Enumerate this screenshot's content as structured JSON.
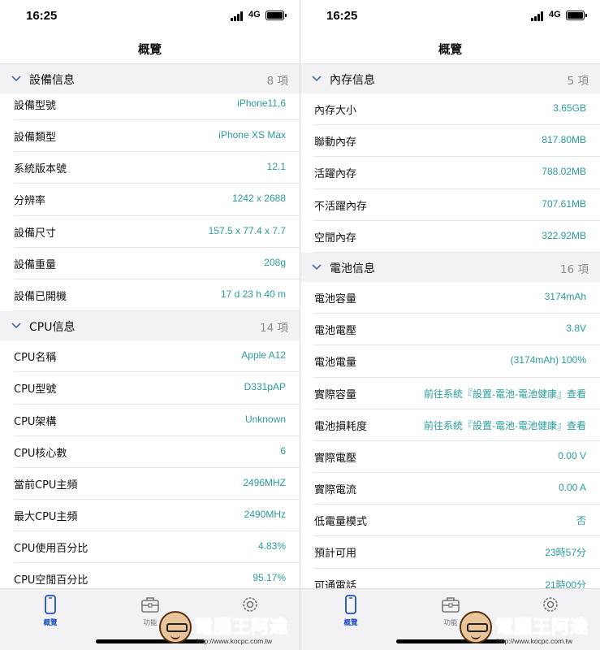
{
  "status": {
    "time": "16:25",
    "network": "4G"
  },
  "nav_title": "概覽",
  "left_sections": [
    {
      "title": "設備信息",
      "count": "8 項",
      "collapsed": false,
      "rows": [
        {
          "label": "設備型號",
          "value": "iPhone11,6"
        },
        {
          "label": "設備類型",
          "value": "iPhone XS Max"
        },
        {
          "label": "系統版本號",
          "value": "12.1"
        },
        {
          "label": "分辨率",
          "value": "1242 x 2688"
        },
        {
          "label": "設備尺寸",
          "value": "157.5 x 77.4 x 7.7"
        },
        {
          "label": "設備重量",
          "value": "208g"
        },
        {
          "label": "設備已開機",
          "value": "17 d 23 h 40 m"
        }
      ]
    },
    {
      "title": "CPU信息",
      "count": "14 項",
      "collapsed": false,
      "rows": [
        {
          "label": "CPU名稱",
          "value": "Apple A12"
        },
        {
          "label": "CPU型號",
          "value": "D331pAP"
        },
        {
          "label": "CPU架構",
          "value": "Unknown"
        },
        {
          "label": "CPU核心數",
          "value": "6"
        },
        {
          "label": "當前CPU主頻",
          "value": "2496MHZ"
        },
        {
          "label": "最大CPU主頻",
          "value": "2490MHz"
        },
        {
          "label": "CPU使用百分比",
          "value": "4.83%"
        },
        {
          "label": "CPU空閒百分比",
          "value": "95.17%"
        }
      ]
    }
  ],
  "right_sections": [
    {
      "title": "內存信息",
      "count": "5 項",
      "collapsed": false,
      "rows": [
        {
          "label": "內存大小",
          "value": "3.65GB"
        },
        {
          "label": "聯動內存",
          "value": "817.80MB"
        },
        {
          "label": "活躍內存",
          "value": "788.02MB"
        },
        {
          "label": "不活躍內存",
          "value": "707.61MB"
        },
        {
          "label": "空閒內存",
          "value": "322.92MB"
        }
      ]
    },
    {
      "title": "電池信息",
      "count": "16 項",
      "collapsed": false,
      "rows": [
        {
          "label": "電池容量",
          "value": "3174mAh"
        },
        {
          "label": "電池電壓",
          "value": "3.8V"
        },
        {
          "label": "電池電量",
          "value": "(3174mAh) 100%"
        },
        {
          "label": "實際容量",
          "value": "前往系統『設置-電池-電池健康』查看"
        },
        {
          "label": "電池損耗度",
          "value": "前往系統『設置-電池-電池健康』查看"
        },
        {
          "label": "實際電壓",
          "value": "0.00 V"
        },
        {
          "label": "實際電流",
          "value": "0.00 A"
        },
        {
          "label": "低電量模式",
          "value": "否"
        },
        {
          "label": "預計可用",
          "value": "23時57分"
        },
        {
          "label": "可通電話",
          "value": "21時00分"
        }
      ]
    }
  ],
  "tabs": [
    {
      "label": "概覽",
      "icon": "phone-icon",
      "active": true
    },
    {
      "label": "功能",
      "icon": "toolbox-icon",
      "active": false
    },
    {
      "label": "",
      "icon": "gear-icon",
      "active": false
    }
  ],
  "watermark": {
    "brand": "電腦王阿達",
    "url": "http://www.kocpc.com.tw"
  },
  "colors": {
    "value": "#2a9d9b",
    "section_bg": "#f2f2f4",
    "active_tab": "#1f4fbf"
  }
}
